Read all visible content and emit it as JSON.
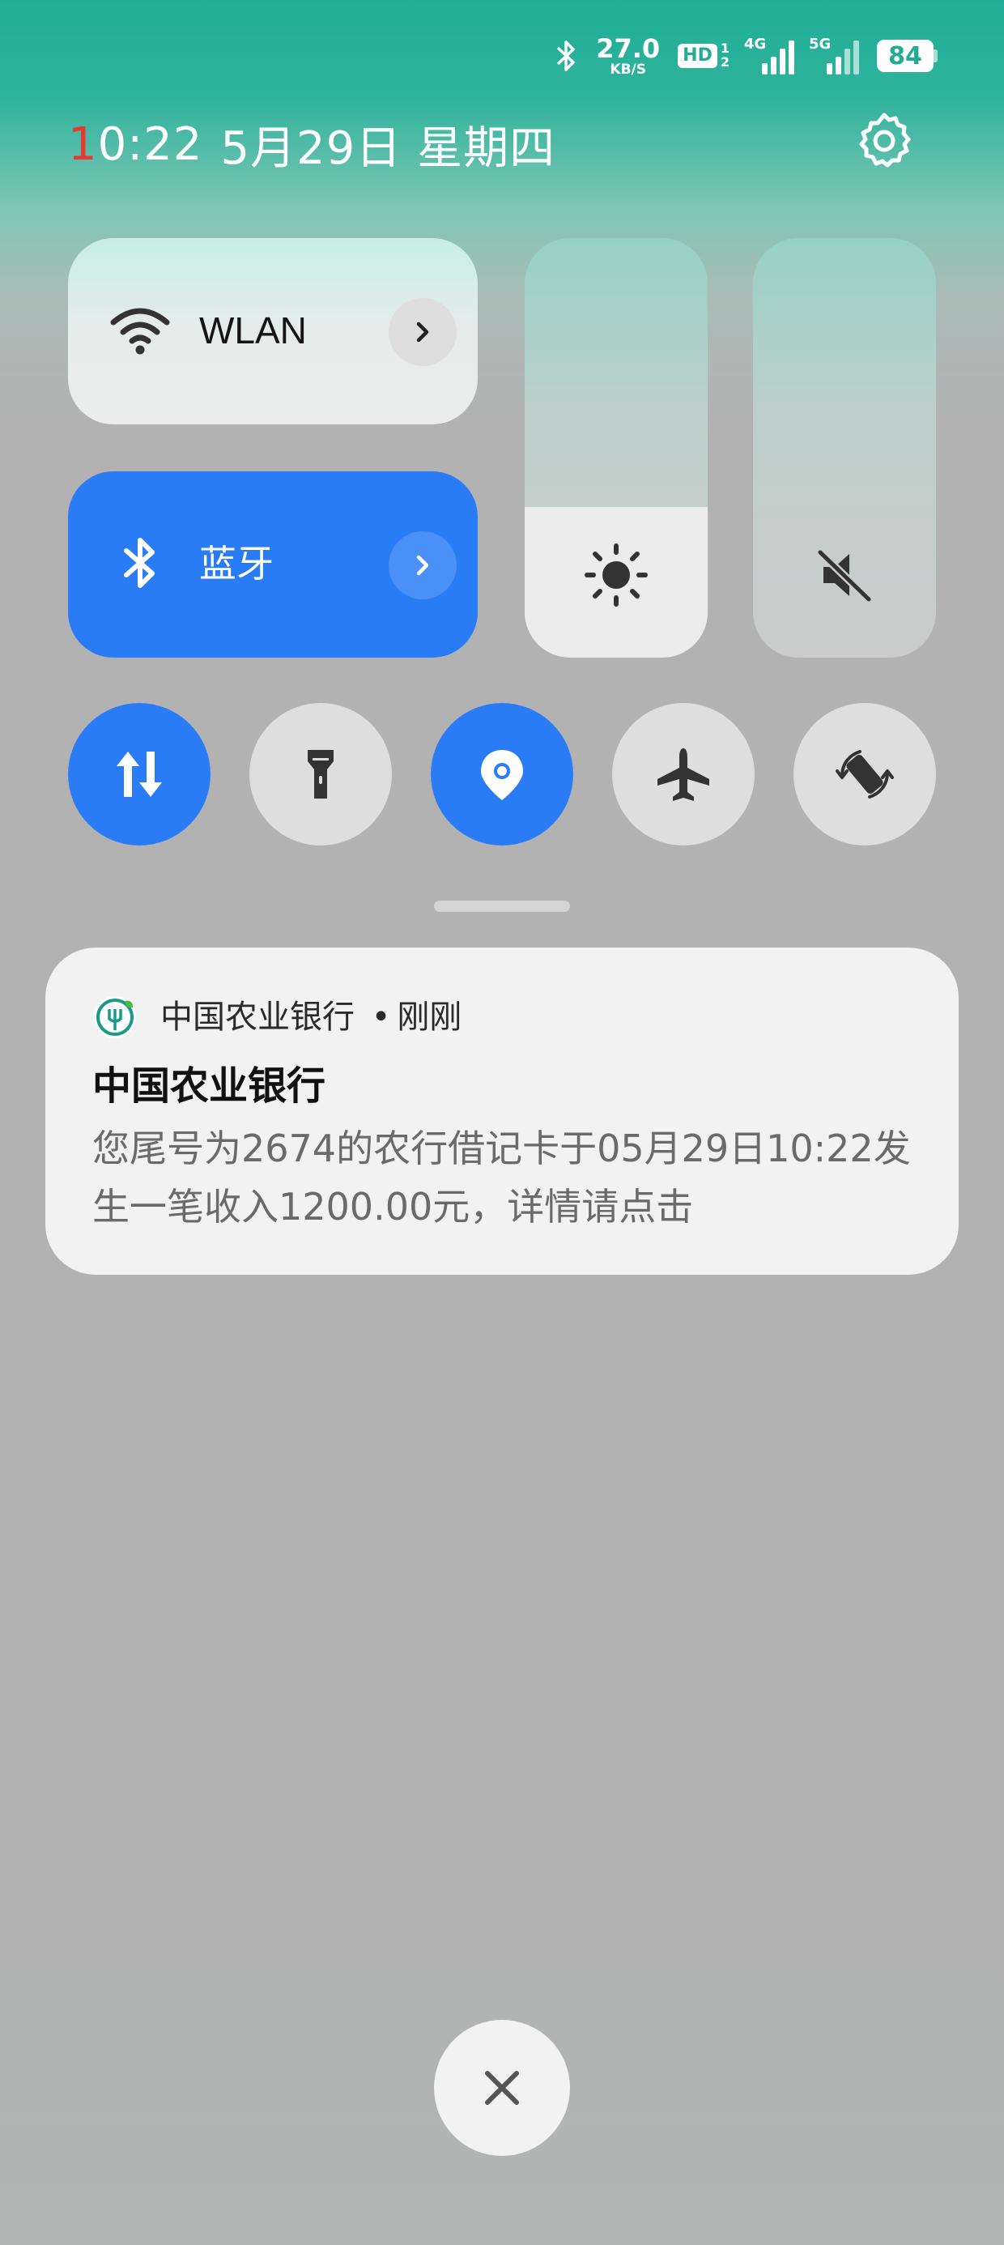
{
  "status_bar": {
    "speed_value": "27.0",
    "speed_unit": "KB/S",
    "hd_label": "HD",
    "sim_top": "1",
    "sim_bottom": "2",
    "net1_label": "4G",
    "net2_label": "5G",
    "battery": "84"
  },
  "header": {
    "time_first_digit": "1",
    "time_rest": "0:22",
    "date": "5月29日 星期四"
  },
  "tiles": {
    "wlan_label": "WLAN",
    "bluetooth_label": "蓝牙",
    "brightness_level": 0.36,
    "volume_level": 0.0
  },
  "toggles": [
    {
      "name": "mobile-data",
      "on": true
    },
    {
      "name": "flashlight",
      "on": false
    },
    {
      "name": "location",
      "on": true
    },
    {
      "name": "airplane-mode",
      "on": false
    },
    {
      "name": "auto-rotate",
      "on": false
    }
  ],
  "notification": {
    "app_name": "中国农业银行",
    "separator": "•",
    "time": "刚刚",
    "title": "中国农业银行",
    "body": "您尾号为2674的农行借记卡于05月29日10:22发生一笔收入1200.00元，详情请点击"
  },
  "colors": {
    "accent": "#2a7cf6",
    "header_teal": "#1fae95",
    "time_red": "#e8392f"
  }
}
